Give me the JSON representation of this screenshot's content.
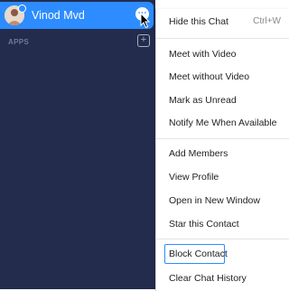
{
  "chat": {
    "name": "Vinod Mvd",
    "more_icon": "ellipsis-icon"
  },
  "apps": {
    "label": "APPS",
    "add_icon": "plus-icon",
    "add_symbol": "+"
  },
  "menu": {
    "hide_chat": {
      "label": "Hide this Chat",
      "shortcut": "Ctrl+W"
    },
    "meet_with_video": "Meet with Video",
    "meet_without_video": "Meet without Video",
    "mark_unread": "Mark as Unread",
    "notify_available": "Notify Me When Available",
    "add_members": "Add Members",
    "view_profile": "View Profile",
    "open_new_window": "Open in New Window",
    "star_contact": "Star this Contact",
    "block_contact": "Block Contact",
    "clear_history": "Clear Chat History"
  },
  "colors": {
    "sidebar_bg": "#232c4d",
    "accent": "#2d8cff",
    "menu_bg": "#ffffff"
  }
}
